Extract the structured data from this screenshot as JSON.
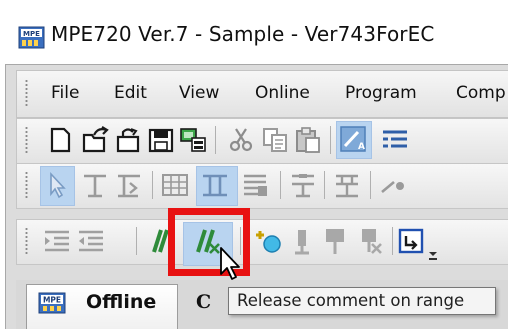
{
  "window": {
    "title": "MPE720 Ver.7 - Sample - Ver743ForEC"
  },
  "menu": {
    "items": [
      {
        "label": "File"
      },
      {
        "label": "Edit"
      },
      {
        "label": "View"
      },
      {
        "label": "Online"
      },
      {
        "label": "Program"
      },
      {
        "label": "Comp"
      }
    ]
  },
  "toolbars": {
    "standard": [
      "new-document-icon",
      "open-icon",
      "open-project-icon",
      "save-icon",
      "connect-icon",
      "cut-icon",
      "copy-icon",
      "paste-icon",
      "find-replace-icon",
      "list-icon"
    ],
    "ladder": [
      "select-pointer-icon",
      "contact-icon",
      "contact-add-icon",
      "grid-icon",
      "coil-icon",
      "register-icon",
      "branch-icon",
      "vertical-line-icon",
      "line-icon"
    ],
    "edit": [
      "indent-icon",
      "outdent-icon",
      "comment-range-icon",
      "release-comment-range-icon",
      "add-element-icon",
      "connector-icon",
      "pin-icon",
      "delete-icon",
      "jump-icon"
    ]
  },
  "highlight": {
    "color": "#e81212"
  },
  "tabs": [
    {
      "label": "Offline"
    },
    {
      "label": "C"
    }
  ],
  "tooltip": {
    "text": "Release comment on range"
  }
}
